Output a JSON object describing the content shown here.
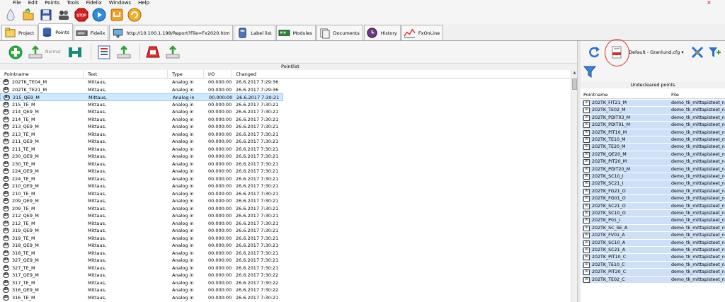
{
  "menu": [
    "File",
    "Edit",
    "Points",
    "Tools",
    "Fidelix",
    "Windows",
    "Help"
  ],
  "close_glyph": "×",
  "main_toolbar": [
    "droplet-icon",
    "open-icon",
    "save-icon",
    "users-icon",
    "stop-icon",
    "play-icon",
    "export-icon",
    "refresh-icon"
  ],
  "tabs": [
    {
      "label": "Project",
      "icon": "project-icon"
    },
    {
      "label": "Points",
      "icon": "database-icon",
      "active": true
    },
    {
      "label": "Fidelix",
      "icon": "device-icon"
    },
    {
      "label": "http://10.100.1.198/Report?File=Fx2020.htm",
      "icon": "monitor-icon"
    },
    {
      "label": "Label list",
      "icon": "label-icon"
    },
    {
      "label": "Modules",
      "icon": "module-icon"
    },
    {
      "label": "Documents",
      "icon": "documents-icon"
    },
    {
      "label": "History",
      "icon": "history-icon"
    },
    {
      "label": "FxOnLine",
      "icon": "chart-icon"
    }
  ],
  "left_toolbar": {
    "normal_label": "Normal"
  },
  "pointlist": {
    "caption": "Pointlist",
    "columns": [
      "Pointname",
      "Text",
      "Type",
      "I/O",
      "Changed"
    ],
    "icon_label": "AI",
    "rows": [
      [
        "202TK_TE04_M",
        "Mittaus,",
        "Analog in",
        "00.000:00",
        "26.6.2017 7:29:36"
      ],
      [
        "202TK_TE21_M",
        "Mittaus,",
        "Analog in",
        "00.000:00",
        "26.6.2017 7:29:36"
      ],
      [
        "215_QE9_M",
        "Mittaus,",
        "Analog in",
        "00.000:00",
        "26.6.2017 7:30:21"
      ],
      [
        "215_TE_M",
        "Mittaus,",
        "Analog in",
        "00.000:00",
        "26.6.2017 7:30:21"
      ],
      [
        "214_QE9_M",
        "Mittaus,",
        "Analog in",
        "00.000:00",
        "26.6.2017 7:30:21"
      ],
      [
        "214_TE_M",
        "Mittaus,",
        "Analog in",
        "00.000:00",
        "26.6.2017 7:30:21"
      ],
      [
        "213_QE9_M",
        "Mittaus,",
        "Analog in",
        "00.000:00",
        "26.6.2017 7:30:21"
      ],
      [
        "213_TE_M",
        "Mittaus,",
        "Analog in",
        "00.000:00",
        "26.6.2017 7:30:21"
      ],
      [
        "211_QE9_M",
        "Mittaus,",
        "Analog in",
        "00.000:00",
        "26.6.2017 7:30:21"
      ],
      [
        "211_TE_M",
        "Mittaus,",
        "Analog in",
        "00.000:00",
        "26.6.2017 7:30:21"
      ],
      [
        "230_QE9_M",
        "Mittaus,",
        "Analog in",
        "00.000:00",
        "26.6.2017 7:30:21"
      ],
      [
        "230_TE_M",
        "Mittaus,",
        "Analog in",
        "00.000:00",
        "26.6.2017 7:30:21"
      ],
      [
        "224_QE9_M",
        "Mittaus,",
        "Analog in",
        "00.000:00",
        "26.6.2017 7:30:21"
      ],
      [
        "224_TE_M",
        "Mittaus,",
        "Analog in",
        "00.000:00",
        "26.6.2017 7:30:21"
      ],
      [
        "210_QE9_M",
        "Mittaus,",
        "Analog in",
        "00.000:00",
        "26.6.2017 7:30:21"
      ],
      [
        "210_TE_M",
        "Mittaus,",
        "Analog in",
        "00.000:00",
        "26.6.2017 7:30:21"
      ],
      [
        "209_QE9_M",
        "Mittaus,",
        "Analog in",
        "00.000:00",
        "26.6.2017 7:30:21"
      ],
      [
        "209_TE_M",
        "Mittaus,",
        "Analog in",
        "00.000:00",
        "26.6.2017 7:30:21"
      ],
      [
        "212_QE9_M",
        "Mittaus,",
        "Analog in",
        "00.000:00",
        "26.6.2017 7:30:21"
      ],
      [
        "212_TE_M",
        "Mittaus,",
        "Analog in",
        "00.000:00",
        "26.6.2017 7:30:21"
      ],
      [
        "319_QE9_M",
        "Mittaus,",
        "Analog in",
        "00.000:00",
        "26.6.2017 7:30:21"
      ],
      [
        "319_TE_M",
        "Mittaus,",
        "Analog in",
        "00.000:00",
        "26.6.2017 7:30:21"
      ],
      [
        "318_QE9_M",
        "Mittaus,",
        "Analog in",
        "00.000:00",
        "26.6.2017 7:30:21"
      ],
      [
        "318_TE_M",
        "Mittaus,",
        "Analog in",
        "00.000:00",
        "26.6.2017 7:30:21"
      ],
      [
        "327_QE9_M",
        "Mittaus,",
        "Analog in",
        "00.000:00",
        "26.6.2017 7:30:21"
      ],
      [
        "327_TE_M",
        "Mittaus,",
        "Analog in",
        "00.000:00",
        "26.6.2017 7:30:21"
      ],
      [
        "317_QE9_M",
        "Mittaus,",
        "Analog in",
        "00.000:00",
        "26.6.2017 7:30:22"
      ],
      [
        "317_TE_M",
        "Mittaus,",
        "Analog in",
        "00.000:00",
        "26.6.2017 7:30:22"
      ],
      [
        "316_QE9_M",
        "Mittaus,",
        "Analog in",
        "00.000:00",
        "26.6.2017 7:30:22"
      ],
      [
        "316_TE_M",
        "Mittaus,",
        "Analog in",
        "00.000:00",
        "26.6.2017 7:30:21"
      ]
    ],
    "selected_index": 2
  },
  "right_toolbar": {
    "config_select": "Default - Granlund.cfg"
  },
  "uncleared": {
    "caption": "Undecleared points",
    "columns": [
      "Pointname",
      "File"
    ],
    "icon_label": "AI",
    "rows": [
      [
        "202TK_FIT21_M",
        "demo_tk_mittapisteet_ni..."
      ],
      [
        "202TK_TE02_M",
        "demo_tk_mittapisteet_ni..."
      ],
      [
        "202TK_PDIT03_M",
        "demo_tk_mittapisteet_ni..."
      ],
      [
        "202TK_PDIT01_M",
        "demo_tk_mittapisteet_ni..."
      ],
      [
        "202TK_PIT10_M",
        "demo_tk_mittapisteet_ni..."
      ],
      [
        "202TK_TE10_M",
        "demo_tk_mittapisteet_ni..."
      ],
      [
        "202TK_TE20_M",
        "demo_tk_mittapisteet_ni..."
      ],
      [
        "202TK_QE20_M",
        "demo_tk_mittapisteet_ni..."
      ],
      [
        "202TK_PIT20_M",
        "demo_tk_mittapisteet_ni..."
      ],
      [
        "202TK_PDIT20_M",
        "demo_tk_mittapisteet_ni..."
      ],
      [
        "202TK_SC10_I",
        "demo_tk_mittapisteet_ni..."
      ],
      [
        "202TK_SC21_I",
        "demo_tk_mittapisteet_ni..."
      ],
      [
        "202TK_FG21_O",
        "demo_tk_mittapisteet_ni..."
      ],
      [
        "202TK_FG01_O",
        "demo_tk_mittapisteet_ni..."
      ],
      [
        "202TK_SC21_O",
        "demo_tk_mittapisteet_ni..."
      ],
      [
        "202TK_SC10_O",
        "demo_tk_mittapisteet_ni..."
      ],
      [
        "202TK_P01_I",
        "demo_tk_mittapisteet_ni..."
      ],
      [
        "202TK_SC_SE_A",
        "demo_tk_mittapisteet_ni..."
      ],
      [
        "202TK_FV01_A",
        "demo_tk_mittapisteet_ni..."
      ],
      [
        "202TK_SC10_A",
        "demo_tk_mittapisteet_ni..."
      ],
      [
        "202TK_SC21_A",
        "demo_tk_mittapisteet_ni..."
      ],
      [
        "202TK_PIT10_C",
        "demo_tk_mittapisteet_ni..."
      ],
      [
        "202TK_TE10_C",
        "demo_tk_mittapisteet_ni..."
      ],
      [
        "202TK_PIT20_C",
        "demo_tk_mittapisteet_ni..."
      ],
      [
        "202TK_TE02_C",
        "demo_tk_mittapisteet_ni..."
      ]
    ]
  }
}
